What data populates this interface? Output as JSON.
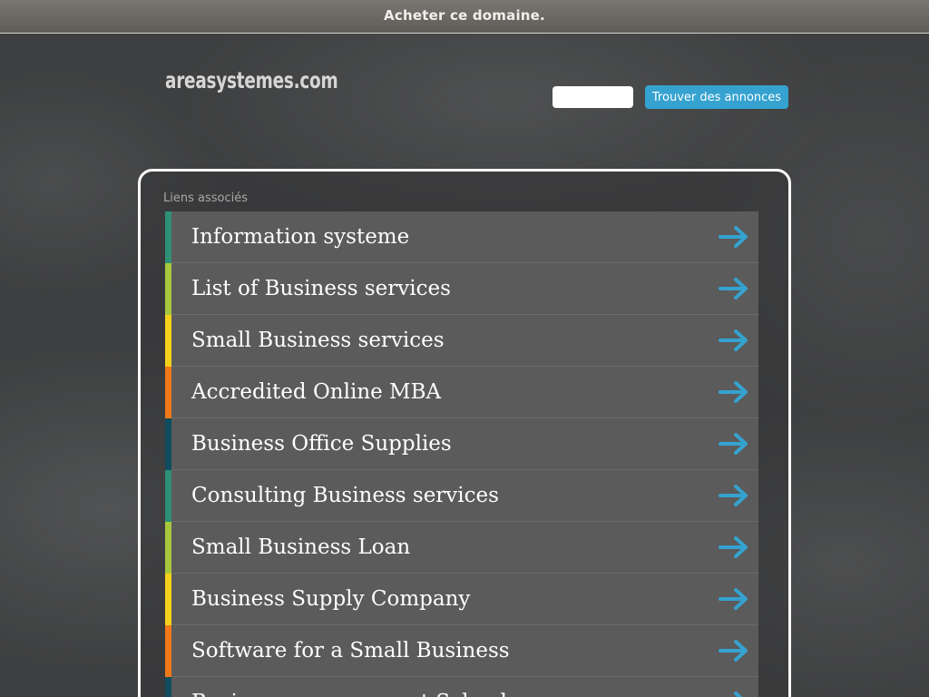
{
  "topbar": {
    "buy_link": "Acheter ce domaine."
  },
  "header": {
    "logo_text": "areasystemes.com",
    "search": {
      "value": "",
      "placeholder": "",
      "button_label": "Trouver des annonces"
    }
  },
  "panel": {
    "title": "Liens associés",
    "links": [
      {
        "label": "Information systeme",
        "color": "#2e8f76"
      },
      {
        "label": "List of Business services",
        "color": "#a8c83c"
      },
      {
        "label": "Small Business services",
        "color": "#f5d21a"
      },
      {
        "label": "Accredited Online MBA",
        "color": "#f07818"
      },
      {
        "label": "Business Office Supplies",
        "color": "#0f4c5e"
      },
      {
        "label": "Consulting Business services",
        "color": "#2e8f76"
      },
      {
        "label": "Small Business Loan",
        "color": "#a8c83c"
      },
      {
        "label": "Business Supply Company",
        "color": "#f5d21a"
      },
      {
        "label": "Software for a Small Business",
        "color": "#f07818"
      },
      {
        "label": "Business management Schools",
        "color": "#0f4c5e"
      }
    ],
    "arrow_icon": "arrow-right-icon",
    "arrow_color": "#35a2d0"
  }
}
